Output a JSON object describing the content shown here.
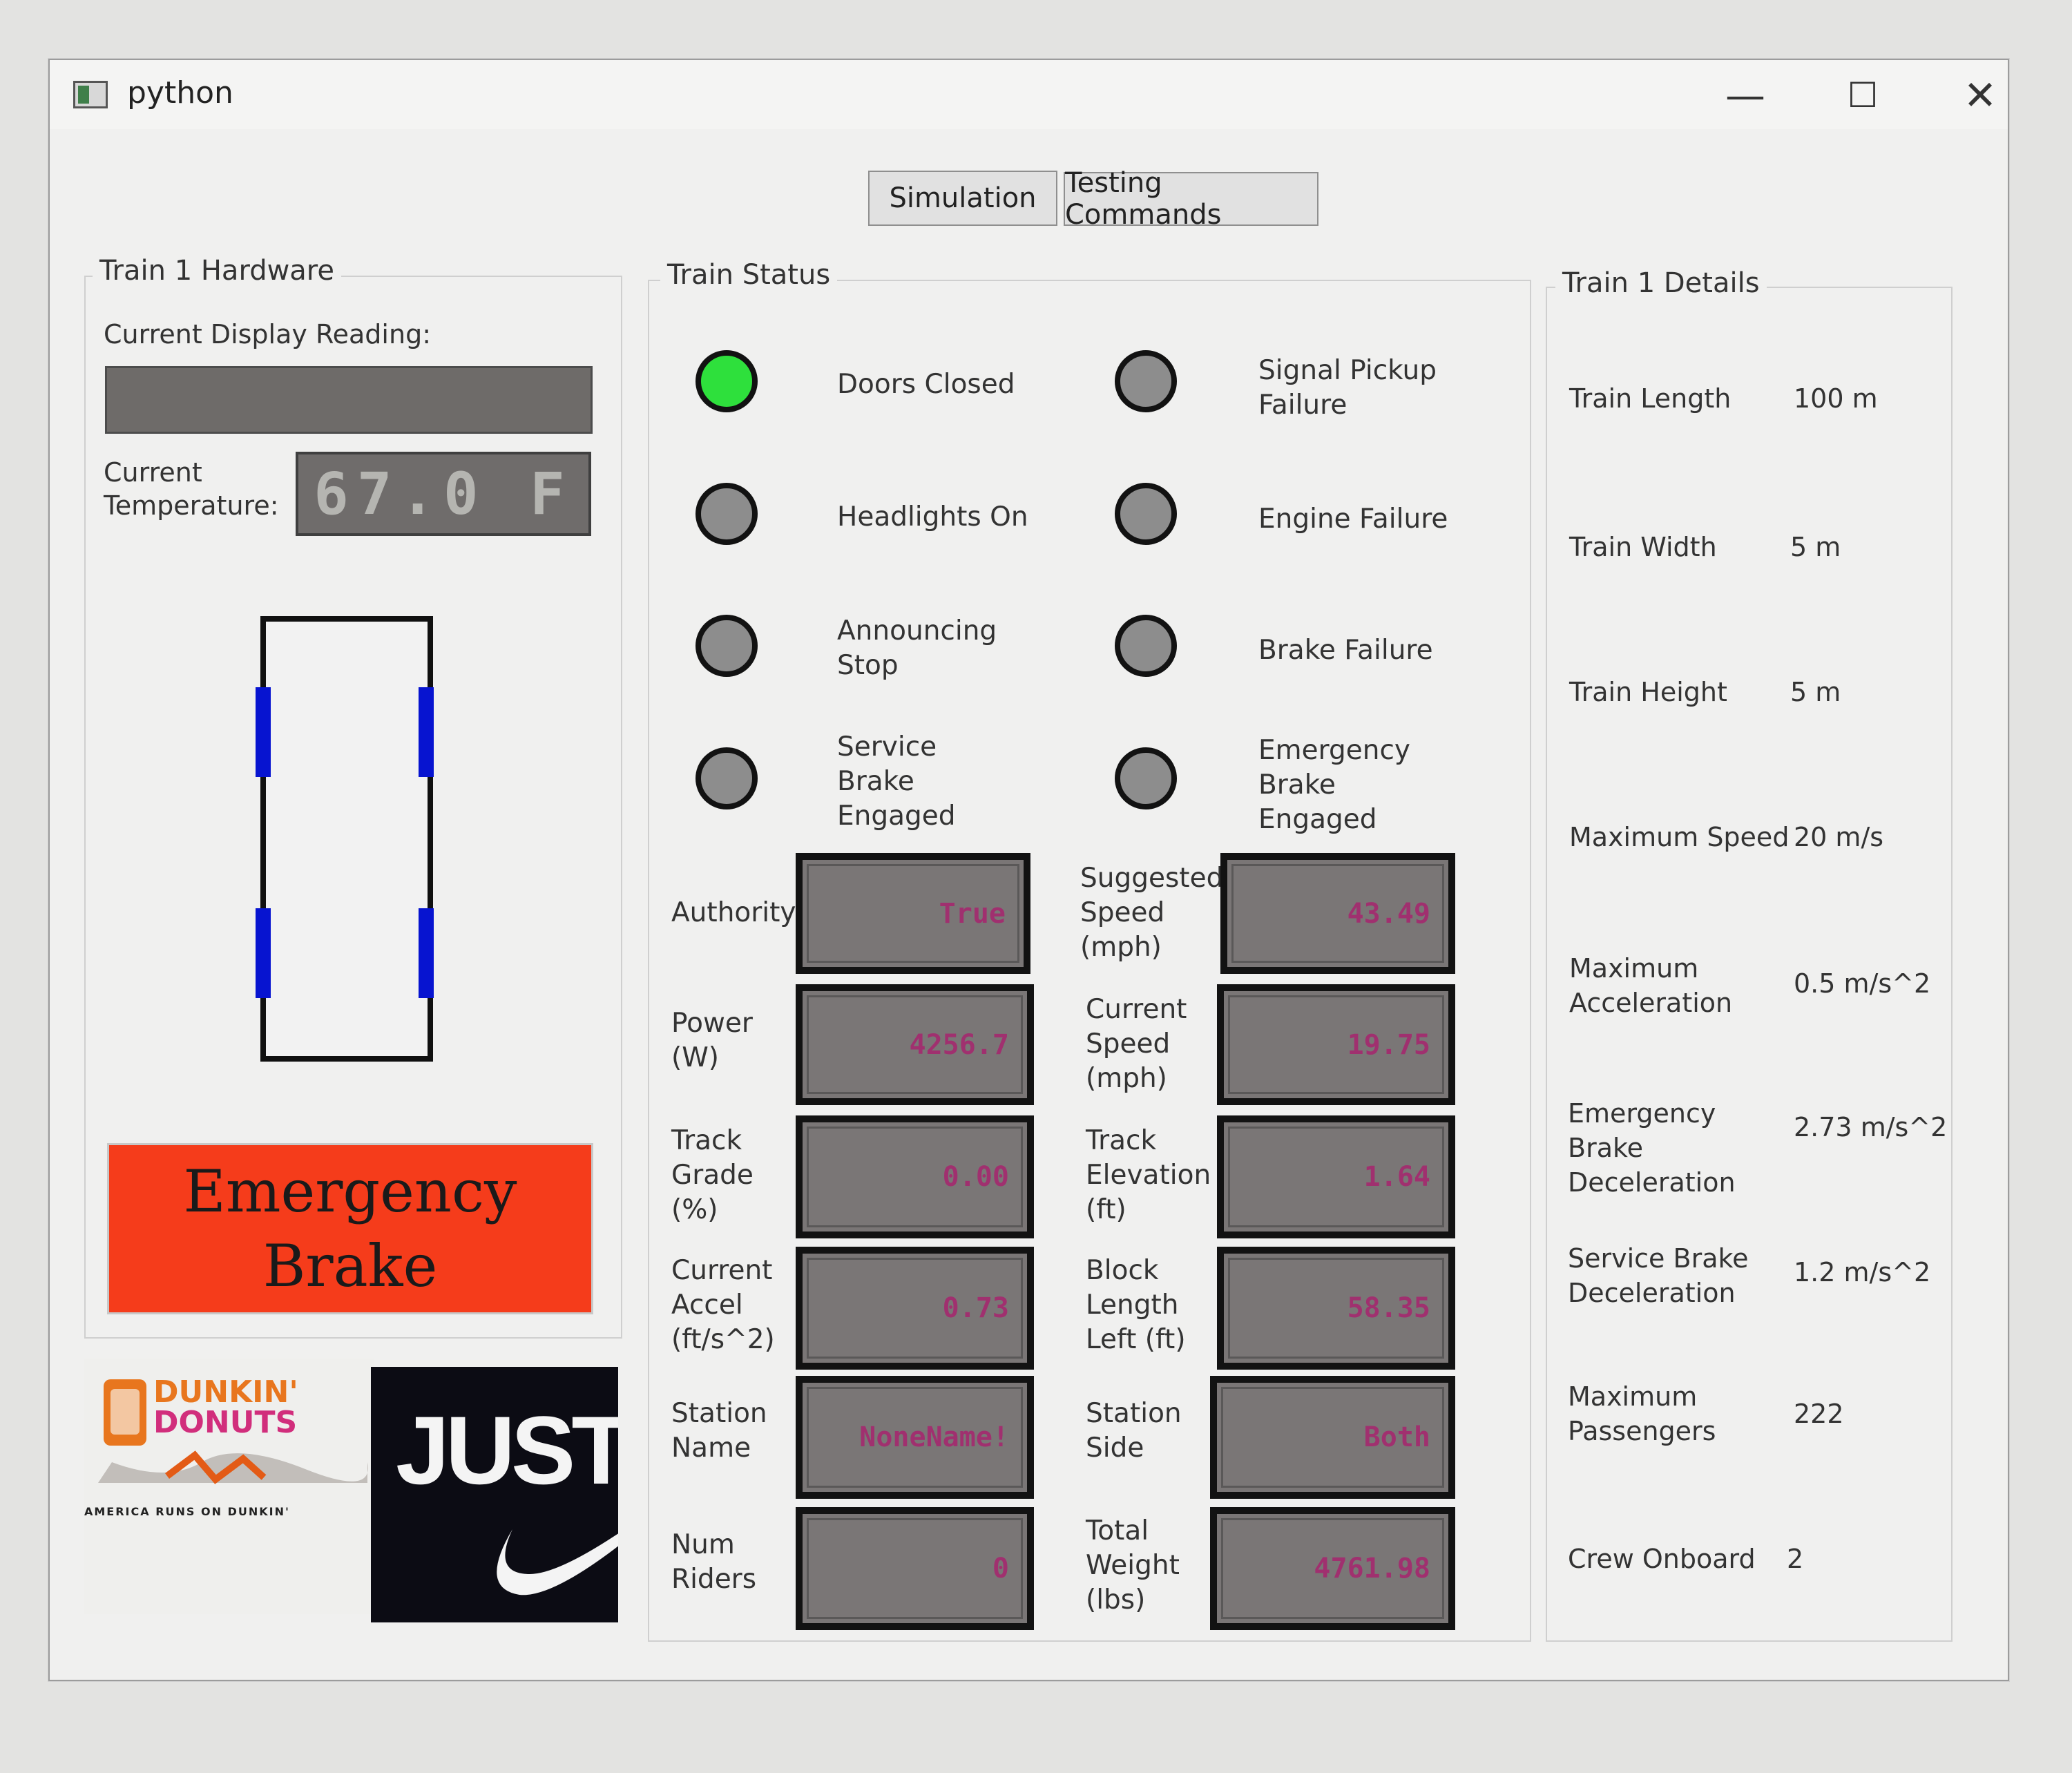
{
  "window": {
    "title": "python",
    "minimize": "—",
    "maximize": "☐",
    "close": "✕"
  },
  "tabs": [
    {
      "label": "Simulation"
    },
    {
      "label": "Testing Commands"
    }
  ],
  "hardware": {
    "title": "Train 1 Hardware",
    "display_label": "Current Display Reading:",
    "display_value": "",
    "temperature_label_line1": "Current",
    "temperature_label_line2": "Temperature:",
    "temperature_value": "67.0 F",
    "emergency_brake_line1": "Emergency",
    "emergency_brake_line2": "Brake",
    "ads": {
      "dunkin_line1": "DUNKIN'",
      "dunkin_line2": "DONUTS",
      "dunkin_tagline": "AMERICA RUNS ON DUNKIN'",
      "nike_text": "JUST D"
    }
  },
  "status": {
    "title": "Train Status",
    "indicators_left": [
      {
        "label": "Doors Closed",
        "on": true
      },
      {
        "label": "Headlights On",
        "on": false
      },
      {
        "label": "Announcing Stop",
        "on": false
      },
      {
        "label": "Service Brake Engaged",
        "on": false
      }
    ],
    "indicators_right": [
      {
        "label": "Signal Pickup Failure",
        "on": false
      },
      {
        "label": "Engine Failure",
        "on": false
      },
      {
        "label": "Brake Failure",
        "on": false
      },
      {
        "label": "Emergency Brake Engaged",
        "on": false
      }
    ],
    "fields_left": [
      {
        "label": "Authority",
        "value": "True"
      },
      {
        "label": "Power (W)",
        "value": "4256.7"
      },
      {
        "label": "Track Grade (%)",
        "value": "0.00"
      },
      {
        "label": "Current Accel (ft/s^2)",
        "value": "0.73"
      },
      {
        "label": "Station Name",
        "value": "NoneName!"
      },
      {
        "label": "Num Riders",
        "value": "0"
      }
    ],
    "fields_right": [
      {
        "label": "Suggested Speed (mph)",
        "value": "43.49"
      },
      {
        "label": "Current Speed (mph)",
        "value": "19.75"
      },
      {
        "label": "Track Elevation (ft)",
        "value": "1.64"
      },
      {
        "label": "Block Length Left (ft)",
        "value": "58.35"
      },
      {
        "label": "Station Side",
        "value": "Both"
      },
      {
        "label": "Total Weight (lbs)",
        "value": "4761.98"
      }
    ]
  },
  "details": {
    "title": "Train 1 Details",
    "rows": [
      {
        "label": "Train Length",
        "value": "100 m"
      },
      {
        "label": "Train Width",
        "value": "5 m"
      },
      {
        "label": "Train Height",
        "value": "5 m"
      },
      {
        "label": "Maximum Speed",
        "value": "20 m/s"
      },
      {
        "label": "Maximum Acceleration",
        "value": "0.5 m/s^2"
      },
      {
        "label": "Emergency Brake Deceleration",
        "value": "2.73 m/s^2"
      },
      {
        "label": "Service Brake Deceleration",
        "value": "1.2 m/s^2"
      },
      {
        "label": "Maximum Passengers",
        "value": "222"
      },
      {
        "label": "Crew Onboard",
        "value": "2"
      }
    ]
  },
  "colors": {
    "indicator_on": "#2ee03c",
    "indicator_off": "#8d8d8d",
    "emergency_brake": "#f53c1b",
    "door_segment": "#0714d0",
    "value_text": "#a0306f"
  }
}
